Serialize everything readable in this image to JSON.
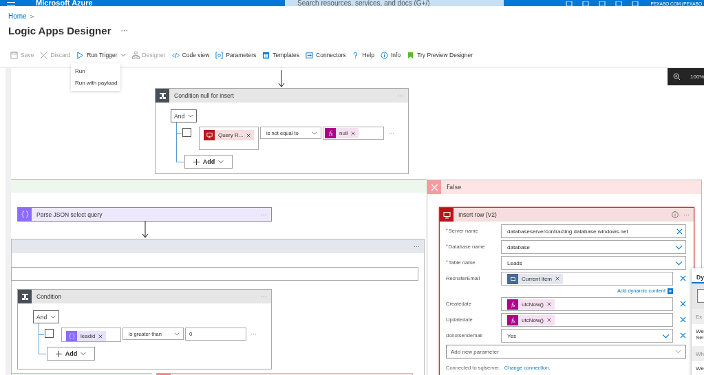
{
  "top_bar": {
    "brand": "Microsoft Azure",
    "search": {
      "placeholder": "Search resources, services, and docs (G+/)"
    },
    "account": "PEXABO.COM (PEXABO"
  },
  "breadcrumb": [
    {
      "label": "Home",
      "sep": ">"
    }
  ],
  "page": {
    "title": "Logic Apps Designer",
    "more": "···"
  },
  "toolbar": [
    {
      "label": "Save",
      "disabled": true
    },
    {
      "label": "Discard",
      "disabled": true
    },
    {
      "label": "Run Trigger",
      "disabled": false,
      "expanded": true
    },
    {
      "label": "Designer",
      "disabled": true
    },
    {
      "label": "Code view",
      "disabled": false
    },
    {
      "label": "Parameters",
      "disabled": false
    },
    {
      "label": "Templates",
      "disabled": false
    },
    {
      "label": "Connectors",
      "disabled": false
    },
    {
      "label": "Help",
      "disabled": false
    },
    {
      "label": "Info",
      "disabled": false
    },
    {
      "label": "Try Preview Designer",
      "disabled": false
    }
  ],
  "run_menu": [
    {
      "label": "Run"
    },
    {
      "label": "Run with payload"
    }
  ],
  "zoom": {
    "reading": "100%"
  },
  "conditions": [
    {
      "title": "Condition null for insert",
      "more": "···",
      "group": "And",
      "rows": [
        {
          "checked": false,
          "left": {
            "kind": "sql",
            "label": "Query R..."
          },
          "operator": "is not equal to",
          "right": {
            "kind": "expression",
            "label": "null"
          },
          "more": "···"
        }
      ],
      "add": "Add"
    },
    {
      "title": "Condition",
      "more": "···",
      "group": "And",
      "rows": [
        {
          "checked": false,
          "left": {
            "kind": "variable",
            "label": "leadid"
          },
          "operator": "is greater than",
          "right": {
            "kind": "text",
            "value": "0"
          },
          "more": "···"
        }
      ],
      "add": "Add"
    }
  ],
  "parse_json": {
    "title": "Parse JSON select query",
    "more": "···"
  },
  "for_each": {
    "more": "···"
  },
  "false_branch": {
    "title": "False"
  },
  "insert_row": {
    "title": "Insert row (V2)",
    "more": "···",
    "fields": [
      {
        "label": "Server name",
        "required_mark": "*",
        "kind": "text",
        "value": "databaseservercontracting.database.windows.net",
        "removable": false
      },
      {
        "label": "Database name",
        "required_mark": "*",
        "kind": "dropdown",
        "value": "database",
        "removable": false
      },
      {
        "label": "Table name",
        "required_mark": "*",
        "kind": "dropdown",
        "value": "Leads",
        "removable": false
      },
      {
        "label": "RecruiterEmail",
        "kind": "token",
        "token": {
          "kind": "loop",
          "label": "Current item"
        },
        "removable": true,
        "link": "Add dynamic content"
      },
      {
        "label": "Createdate",
        "kind": "token",
        "token": {
          "kind": "expression",
          "label": "utcNow()"
        },
        "removable": true
      },
      {
        "label": "Updatedate",
        "kind": "token",
        "token": {
          "kind": "expression",
          "label": "utcNow()"
        },
        "removable": true
      },
      {
        "label": "donotsendemail",
        "kind": "dropdown",
        "value": "Yes",
        "removable": true
      }
    ],
    "add_parameter": {
      "placeholder": "Add new parameter"
    },
    "connection": "Connected to sqlserver.",
    "change_link": "Change connection."
  },
  "dynamic_panel": {
    "tab": {
      "label": "Dy",
      "selected": true
    },
    "sections": [
      {
        "kind": "heading",
        "text": "Ex"
      },
      {
        "kind": "item",
        "text": "We Sel"
      },
      {
        "kind": "heading",
        "text": "Wh"
      },
      {
        "kind": "item",
        "text": "We"
      }
    ]
  }
}
